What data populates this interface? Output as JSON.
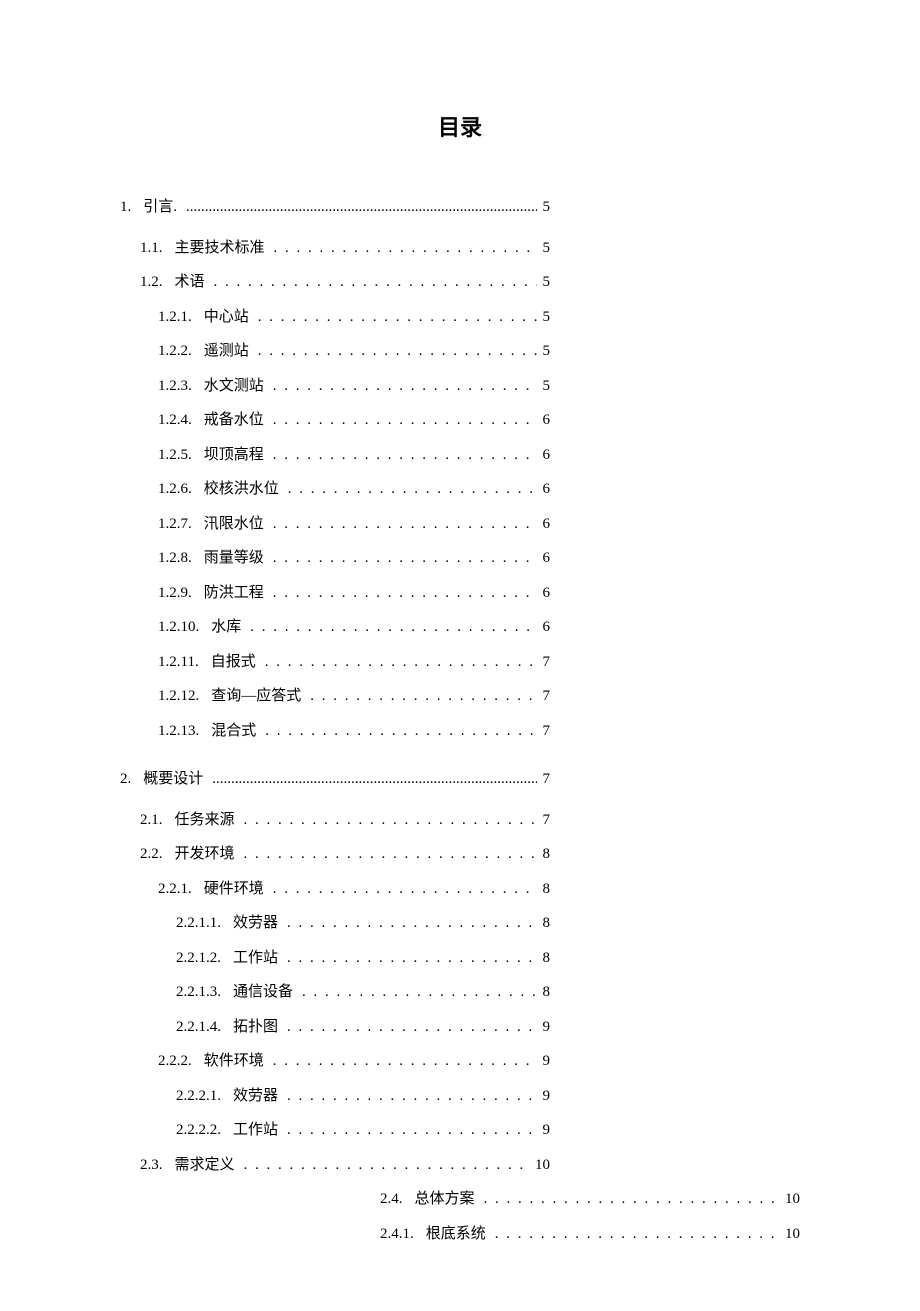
{
  "title": "目录",
  "entries": [
    {
      "num": "1.",
      "label": "引言.",
      "page": "5",
      "level": 0,
      "cls": "chapter",
      "wrap": "wrap"
    },
    {
      "num": "1.1.",
      "label": "主要技术标准",
      "page": "5",
      "level": 1,
      "cls": "",
      "wrap": "wrap"
    },
    {
      "num": "1.2.",
      "label": "术语",
      "page": "5",
      "level": 1,
      "cls": "",
      "wrap": "wrap"
    },
    {
      "num": "1.2.1.",
      "label": "中心站",
      "page": "5",
      "level": 2,
      "cls": "",
      "wrap": "wrap"
    },
    {
      "num": "1.2.2.",
      "label": "遥测站",
      "page": "5",
      "level": 2,
      "cls": "",
      "wrap": "wrap"
    },
    {
      "num": "1.2.3.",
      "label": "水文测站",
      "page": "5",
      "level": 2,
      "cls": "",
      "wrap": "wrap"
    },
    {
      "num": "1.2.4.",
      "label": "戒备水位",
      "page": "6",
      "level": 2,
      "cls": "",
      "wrap": "wrap"
    },
    {
      "num": "1.2.5.",
      "label": "坝顶高程",
      "page": "6",
      "level": 2,
      "cls": "",
      "wrap": "wrap"
    },
    {
      "num": "1.2.6.",
      "label": "校核洪水位",
      "page": "6",
      "level": 2,
      "cls": "",
      "wrap": "wrap"
    },
    {
      "num": "1.2.7.",
      "label": "汛限水位",
      "page": "6",
      "level": 2,
      "cls": "",
      "wrap": "wrap"
    },
    {
      "num": "1.2.8.",
      "label": "雨量等级",
      "page": "6",
      "level": 2,
      "cls": "",
      "wrap": "wrap"
    },
    {
      "num": "1.2.9.",
      "label": "防洪工程",
      "page": "6",
      "level": 2,
      "cls": "",
      "wrap": "wrap"
    },
    {
      "num": "1.2.10.",
      "label": "水库",
      "page": "6",
      "level": 2,
      "cls": "",
      "wrap": "wrap"
    },
    {
      "num": "1.2.11.",
      "label": "自报式",
      "page": "7",
      "level": 2,
      "cls": "",
      "wrap": "wrap"
    },
    {
      "num": "1.2.12.",
      "label": "查询—应答式",
      "page": "7",
      "level": 2,
      "cls": "",
      "wrap": "wrap"
    },
    {
      "num": "1.2.13.",
      "label": "混合式",
      "page": "7",
      "level": 2,
      "cls": "",
      "wrap": "wrap"
    },
    {
      "num": "2.",
      "label": "概要设计",
      "page": "7",
      "level": 0,
      "cls": "chapter",
      "wrap": "wrap"
    },
    {
      "num": "2.1.",
      "label": "任务来源",
      "page": "7",
      "level": 1,
      "cls": "",
      "wrap": "wrap"
    },
    {
      "num": "2.2.",
      "label": "开发环境",
      "page": "8",
      "level": 1,
      "cls": "",
      "wrap": "wrap"
    },
    {
      "num": "2.2.1.",
      "label": "硬件环境",
      "page": "8",
      "level": 2,
      "cls": "",
      "wrap": "wrap"
    },
    {
      "num": "2.2.1.1.",
      "label": "效劳器",
      "page": "8",
      "level": 3,
      "cls": "",
      "wrap": "wrap"
    },
    {
      "num": "2.2.1.2.",
      "label": "工作站",
      "page": "8",
      "level": 3,
      "cls": "",
      "wrap": "wrap"
    },
    {
      "num": "2.2.1.3.",
      "label": "通信设备",
      "page": "8",
      "level": 3,
      "cls": "",
      "wrap": "wrap"
    },
    {
      "num": "2.2.1.4.",
      "label": "拓扑图",
      "page": "9",
      "level": 3,
      "cls": "",
      "wrap": "wrap"
    },
    {
      "num": "2.2.2.",
      "label": "软件环境",
      "page": "9",
      "level": 2,
      "cls": "",
      "wrap": "wrap"
    },
    {
      "num": "2.2.2.1.",
      "label": "效劳器",
      "page": "9",
      "level": 3,
      "cls": "",
      "wrap": "wrap"
    },
    {
      "num": "2.2.2.2.",
      "label": "工作站",
      "page": "9",
      "level": 3,
      "cls": "",
      "wrap": "wrap"
    },
    {
      "num": "2.3.",
      "label": "需求定义",
      "page": "10",
      "level": 1,
      "cls": "",
      "wrap": "wrap"
    },
    {
      "num": "2.4.",
      "label": "总体方案",
      "page": "10",
      "level": 0,
      "cls": "shifted",
      "wrap": "wrap-wide"
    },
    {
      "num": "2.4.1.",
      "label": "根底系统",
      "page": "10",
      "level": 0,
      "cls": "shifted",
      "wrap": "wrap-wide"
    }
  ]
}
